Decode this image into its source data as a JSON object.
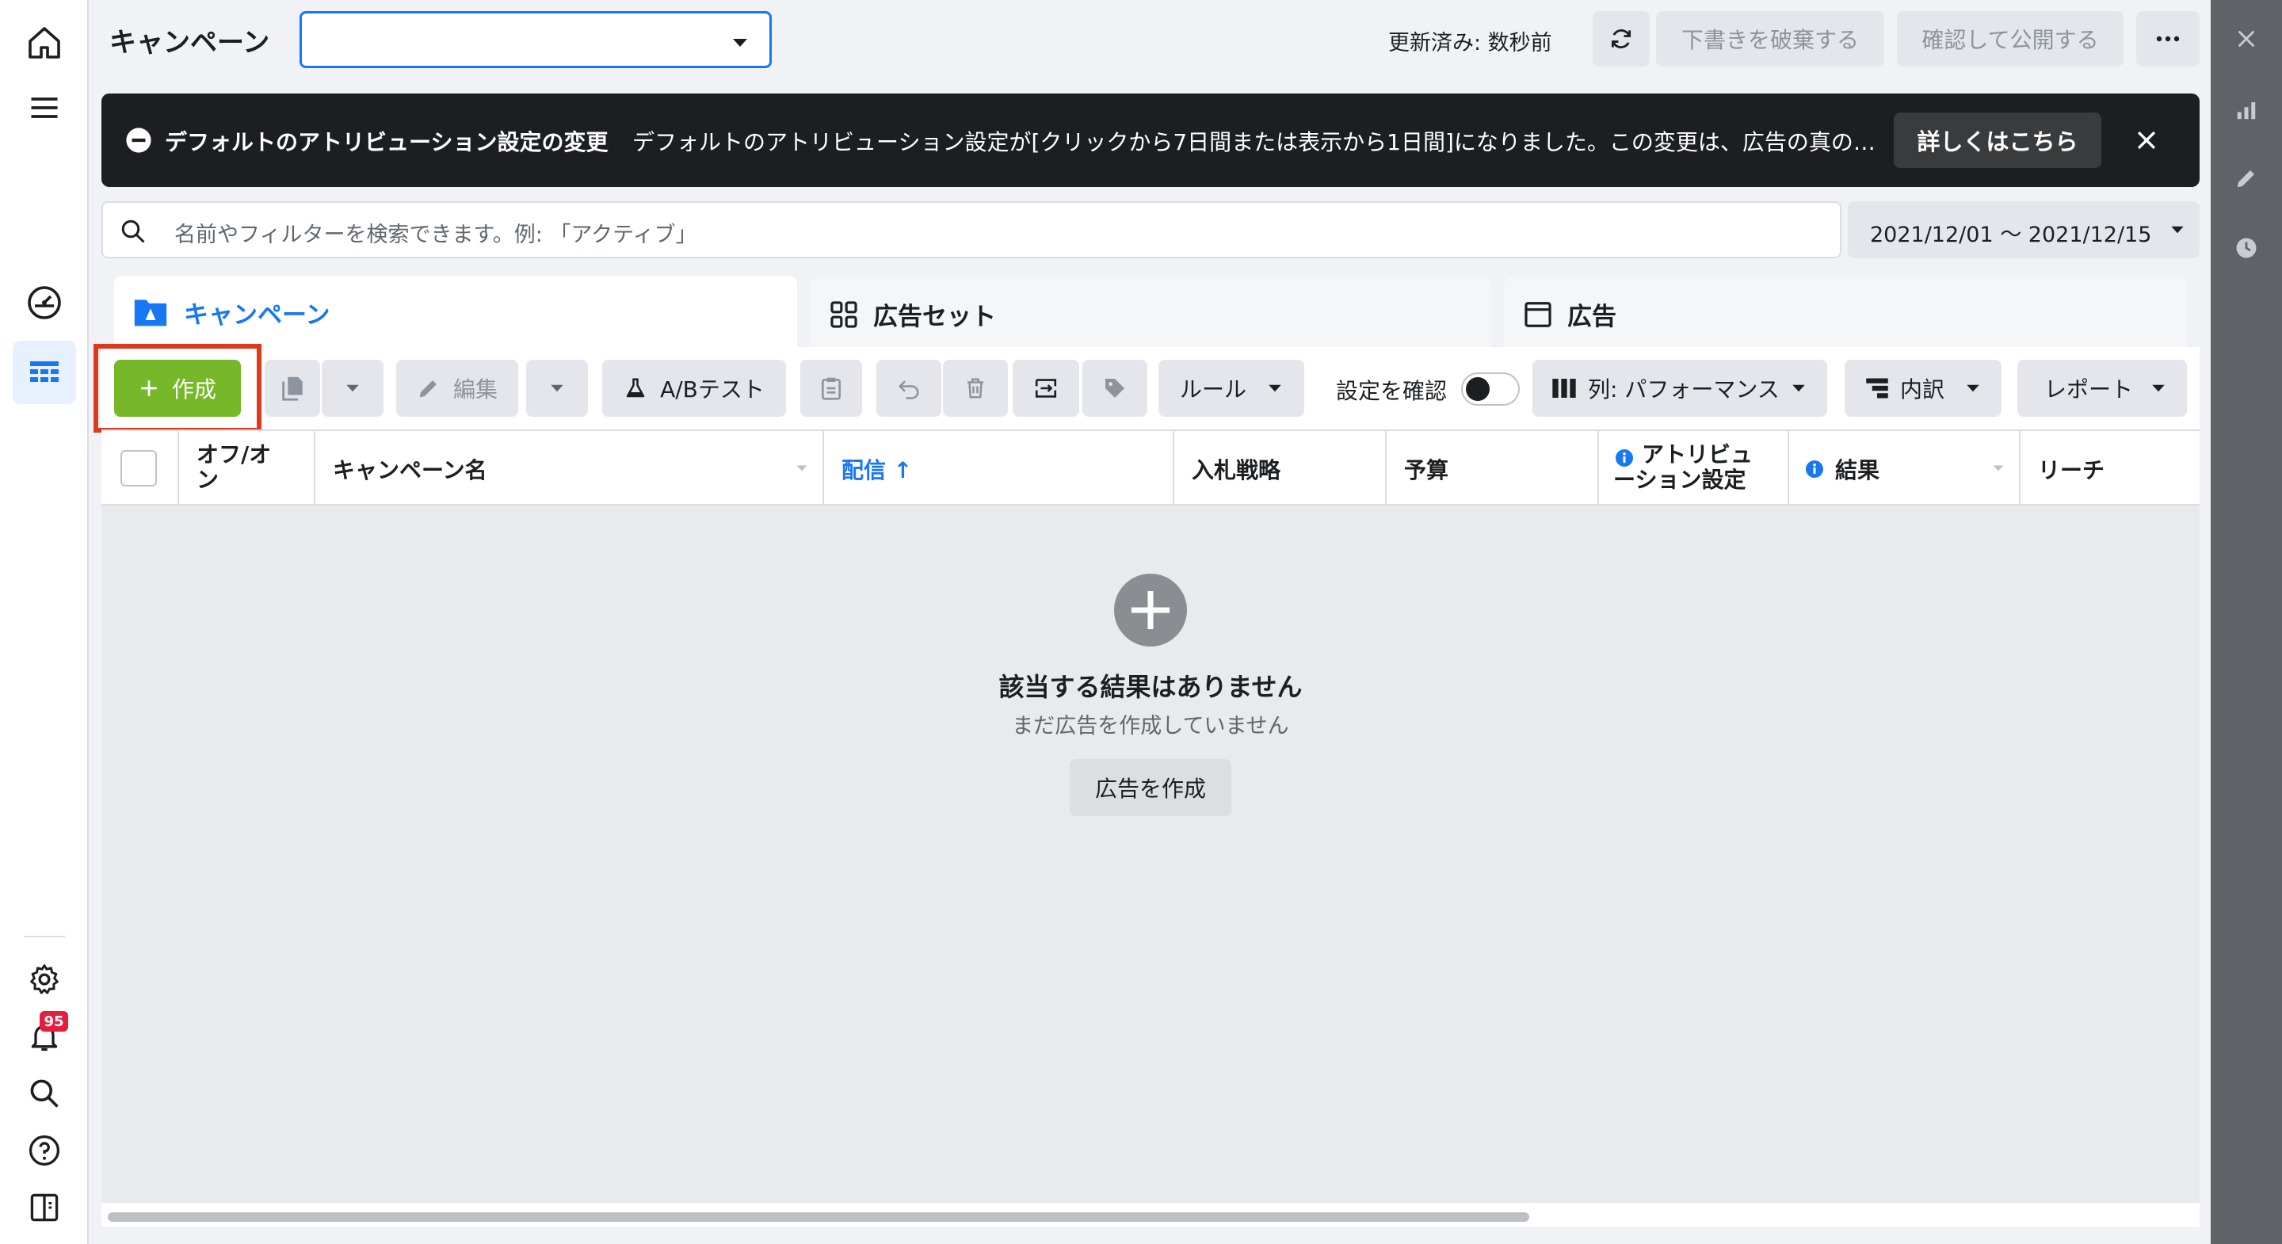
{
  "header": {
    "title": "キャンペーン",
    "updated": "更新済み: 数秒前",
    "discard_label": "下書きを破棄する",
    "publish_label": "確認して公開する"
  },
  "banner": {
    "title": "デフォルトのアトリビューション設定の変更",
    "message": "デフォルトのアトリビューション設定が[クリックから7日間または表示から1日間]になりました。この変更は、広告の真の…",
    "learn_more": "詳しくはこちら"
  },
  "search": {
    "placeholder": "名前やフィルターを検索できます。例: 「アクティブ」",
    "date_range": "2021/12/01 〜 2021/12/15"
  },
  "tabs": [
    {
      "label": "キャンペーン"
    },
    {
      "label": "広告セット"
    },
    {
      "label": "広告"
    }
  ],
  "toolbar": {
    "create": "作成",
    "edit": "編集",
    "ab_test": "A/Bテスト",
    "rules": "ルール",
    "review_settings": "設定を確認",
    "columns": "列: パフォーマンス",
    "breakdown": "内訳",
    "reports": "レポート"
  },
  "table": {
    "columns": [
      "オフ/オン",
      "キャンペーン名",
      "配信 ↑",
      "入札戦略",
      "予算",
      "アトリビューション設定",
      "結果",
      "リーチ"
    ],
    "attribution_line1": "アトリビュ",
    "attribution_line2": "ーション設定",
    "onoff_line1": "オフ/オ",
    "onoff_line2": "ン"
  },
  "empty_state": {
    "title": "該当する結果はありません",
    "subtitle": "まだ広告を作成していません",
    "button": "広告を作成"
  },
  "notifications": {
    "count": "95"
  },
  "colors": {
    "accent": "#1877f2",
    "create_green": "#76b82a",
    "highlight_red": "#e0381b",
    "banner_bg": "#1c1e21"
  }
}
